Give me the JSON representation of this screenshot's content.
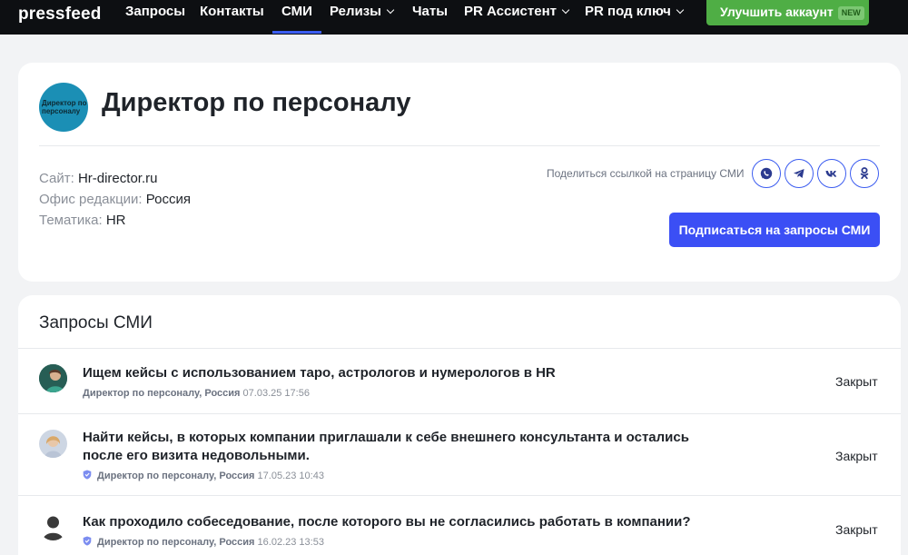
{
  "nav": {
    "logo": "pressfeed",
    "items": [
      {
        "label": "Запросы",
        "dropdown": false
      },
      {
        "label": "Контакты",
        "dropdown": false
      },
      {
        "label": "СМИ",
        "dropdown": false,
        "active": true
      },
      {
        "label": "Релизы",
        "dropdown": true
      },
      {
        "label": "Чаты",
        "dropdown": false
      },
      {
        "label": "PR Ассистент",
        "dropdown": true
      },
      {
        "label": "PR под ключ",
        "dropdown": true
      }
    ],
    "upgrade_label": "Улучшить аккаунт",
    "upgrade_badge": "NEW"
  },
  "media": {
    "logo_text": "Директор по персоналу",
    "title": "Директор по персоналу",
    "site_label": "Сайт:",
    "site_value": "Hr-director.ru",
    "office_label": "Офис редакции:",
    "office_value": "Россия",
    "topic_label": "Тематика:",
    "topic_value": "HR",
    "share_label": "Поделиться ссылкой на страницу СМИ",
    "share_icons": [
      "whatsapp-icon",
      "telegram-icon",
      "vk-icon",
      "odnoklassniki-icon"
    ],
    "subscribe_label": "Подписаться на запросы СМИ"
  },
  "requests": {
    "title": "Запросы СМИ",
    "items": [
      {
        "title": "Ищем кейсы с использованием таро, астрологов и нумерологов в HR",
        "author": "Директор по персоналу, Россия",
        "date": "07.03.25 17:56",
        "verified": false,
        "status": "Закрыт"
      },
      {
        "title": "Найти кейсы, в которых компании приглашали к себе внешнего консультанта и остались после его визита недовольными.",
        "author": "Директор по персоналу, Россия",
        "date": "17.05.23 10:43",
        "verified": true,
        "status": "Закрыт"
      },
      {
        "title": "Как проходило собеседование, после которого вы не согласились работать в компании?",
        "author": "Директор по персоналу, Россия",
        "date": "16.02.23 13:53",
        "verified": true,
        "status": "Закрыт"
      }
    ]
  },
  "colors": {
    "accent": "#3b4ff5",
    "upgrade": "#4fae45",
    "topbar": "#0d0f12"
  }
}
